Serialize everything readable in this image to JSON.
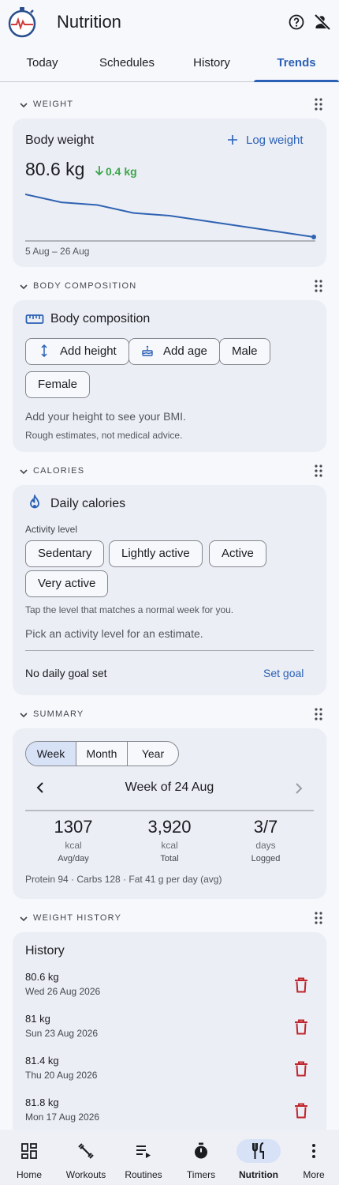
{
  "app": {
    "title": "Nutrition"
  },
  "tabs": [
    {
      "label": "Today"
    },
    {
      "label": "Schedules"
    },
    {
      "label": "History"
    },
    {
      "label": "Trends",
      "active": true
    }
  ],
  "weight_section": {
    "header": "WEIGHT",
    "card_title": "Body weight",
    "log_button": "Log weight",
    "current": "80.6 kg",
    "delta": "0.4 kg",
    "range_label": "5 Aug – 26 Aug",
    "chart_data": {
      "type": "line",
      "trend": [
        82.2,
        81.9,
        81.8,
        81.5,
        81.4,
        81.2,
        81.0,
        80.8,
        80.6
      ]
    }
  },
  "body_section": {
    "header": "BODY COMPOSITION",
    "card_title": "Body composition",
    "chips": [
      "Add height",
      "Add age",
      "Male",
      "Female"
    ],
    "hint": "Add your height to see your BMI.",
    "disclaimer": "Rough estimates, not medical advice."
  },
  "calories_section": {
    "header": "CALORIES",
    "card_title": "Daily calories",
    "activity_label": "Activity level",
    "levels": [
      "Sedentary",
      "Lightly active",
      "Active",
      "Very active"
    ],
    "tap_hint": "Tap the level that matches a normal week for you.",
    "estimate_hint": "Pick an activity level for an estimate.",
    "goal_text": "No daily goal set",
    "goal_button": "Set goal"
  },
  "summary_section": {
    "header": "SUMMARY",
    "segments": [
      "Week",
      "Month",
      "Year"
    ],
    "selected_segment": "Week",
    "period": "Week of 24 Aug",
    "stats": [
      {
        "value": "1307",
        "unit": "kcal",
        "label": "Avg/day"
      },
      {
        "value": "3,920",
        "unit": "kcal",
        "label": "Total"
      },
      {
        "value": "3/7",
        "unit": "days",
        "label": "Logged"
      }
    ],
    "macros": "Protein 94 · Carbs 128 · Fat 41 g per day (avg)"
  },
  "history_section": {
    "header": "WEIGHT HISTORY",
    "card_title": "History",
    "entries": [
      {
        "weight": "80.6 kg",
        "date": "Wed 26 Aug 2026"
      },
      {
        "weight": "81 kg",
        "date": "Sun 23 Aug 2026"
      },
      {
        "weight": "81.4 kg",
        "date": "Thu 20 Aug 2026"
      },
      {
        "weight": "81.8 kg",
        "date": "Mon 17 Aug 2026"
      }
    ]
  },
  "bottom_nav": [
    {
      "label": "Home",
      "icon": "dashboard-icon"
    },
    {
      "label": "Workouts",
      "icon": "dumbbell-icon"
    },
    {
      "label": "Routines",
      "icon": "playlist-play-icon"
    },
    {
      "label": "Timers",
      "icon": "timer-icon"
    },
    {
      "label": "Nutrition",
      "icon": "fork-knife-icon",
      "active": true
    },
    {
      "label": "More",
      "icon": "more-vert-icon"
    }
  ],
  "colors": {
    "accent": "#2a61b5",
    "positive": "#3aa64a",
    "danger": "#c0262d",
    "card": "#eceef5",
    "background": "#f7f8fc"
  }
}
